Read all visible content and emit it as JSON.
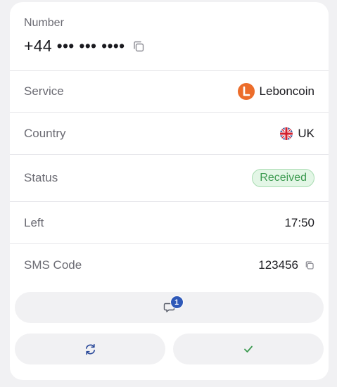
{
  "number": {
    "label": "Number",
    "value": "+44 ••• ••• ••••"
  },
  "details": {
    "service": {
      "label": "Service",
      "value": "Leboncoin",
      "logo_letter": "L",
      "logo_color": "#ec6d2b"
    },
    "country": {
      "label": "Country",
      "value": "UK"
    },
    "status": {
      "label": "Status",
      "value": "Received",
      "color": "#3c9a50"
    },
    "left": {
      "label": "Left",
      "value": "17:50"
    },
    "sms_code": {
      "label": "SMS Code",
      "value": "123456"
    }
  },
  "actions": {
    "messages_count": "1",
    "messages_icon": "chat-bubble-icon",
    "refresh_icon": "refresh-icon",
    "confirm_icon": "checkmark-icon",
    "confirm_color": "#3c9a50"
  }
}
